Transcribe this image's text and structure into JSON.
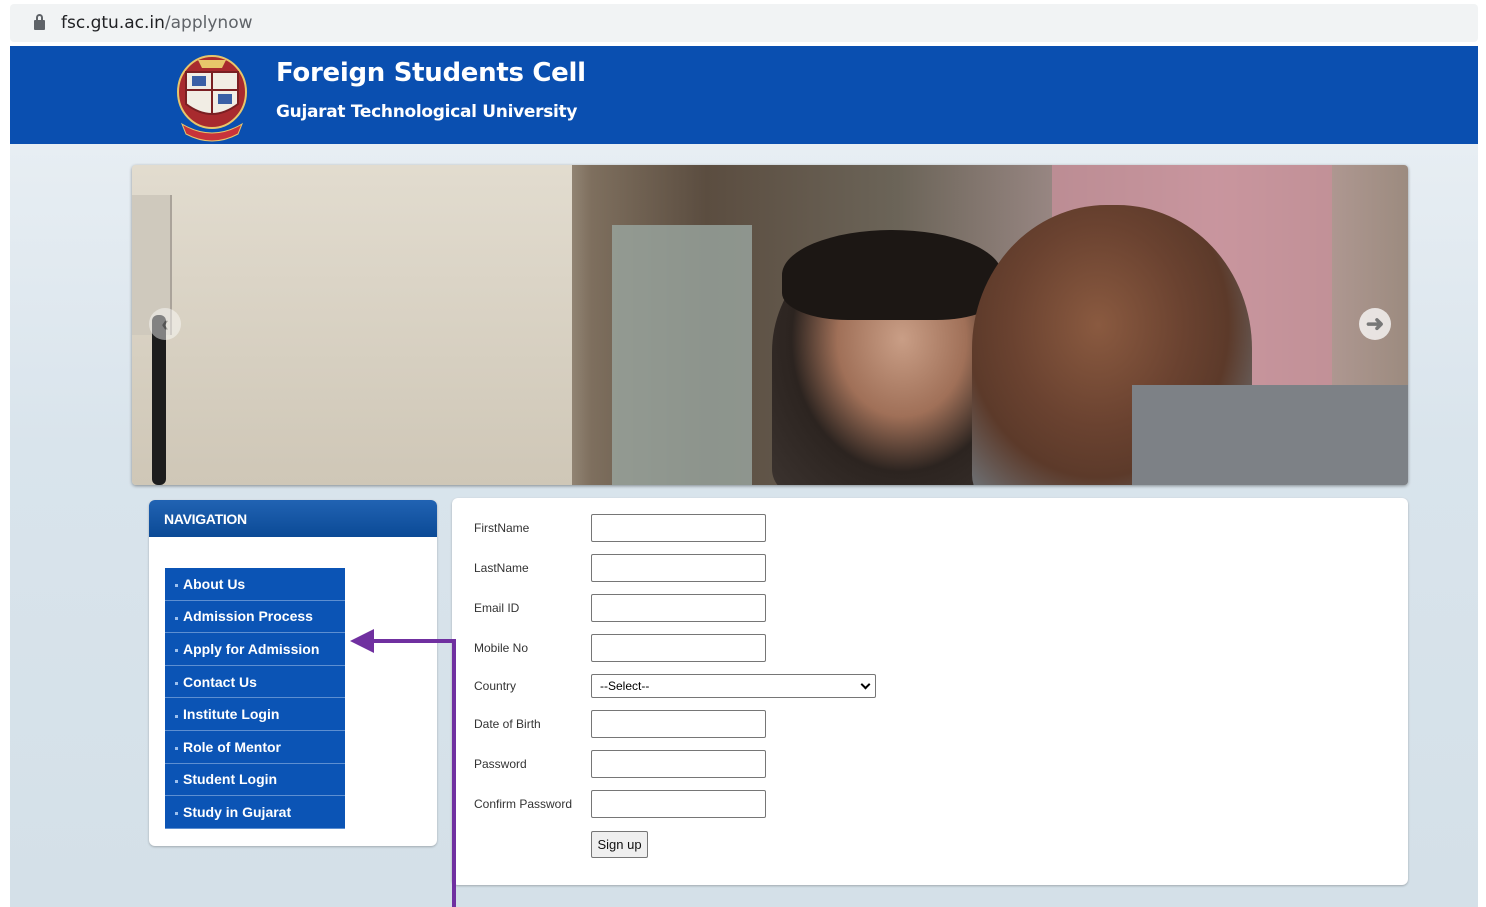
{
  "browser": {
    "url_host": "fsc.gtu.ac.in",
    "url_path": "/applynow"
  },
  "header": {
    "title": "Foreign Students Cell",
    "subtitle": "Gujarat Technological University"
  },
  "navigation": {
    "title": "NAVIGATION",
    "items": [
      {
        "label": "About Us"
      },
      {
        "label": "Admission Process"
      },
      {
        "label": "Apply for Admission"
      },
      {
        "label": "Contact Us"
      },
      {
        "label": "Institute Login"
      },
      {
        "label": "Role of Mentor"
      },
      {
        "label": "Student Login"
      },
      {
        "label": "Study in Gujarat"
      }
    ]
  },
  "form": {
    "fields": [
      {
        "label": "FirstName",
        "value": ""
      },
      {
        "label": "LastName",
        "value": ""
      },
      {
        "label": "Email ID",
        "value": ""
      },
      {
        "label": "Mobile No",
        "value": ""
      },
      {
        "label": "Country",
        "value": "--Select--"
      },
      {
        "label": "Date of Birth",
        "value": ""
      },
      {
        "label": "Password",
        "value": ""
      },
      {
        "label": "Confirm Password",
        "value": ""
      }
    ],
    "submit_label": "Sign up"
  },
  "colors": {
    "header_blue": "#0a4fb0",
    "nav_item_blue": "#0b54b5",
    "annotation_purple": "#7030a0"
  },
  "icons": {
    "lock": "lock-icon",
    "prev": "arrow-left-icon",
    "next": "arrow-right-icon",
    "dropdown": "chevron-down-icon"
  }
}
